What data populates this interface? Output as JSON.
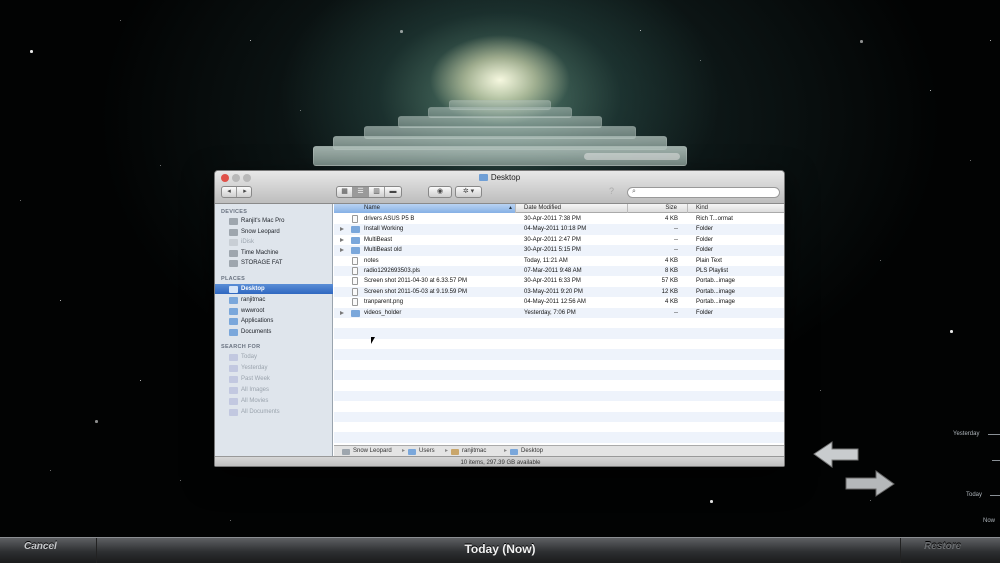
{
  "window": {
    "title": "Desktop",
    "search_placeholder": ""
  },
  "sidebar": {
    "devices_header": "DEVICES",
    "devices": [
      {
        "label": "Ranjit's Mac Pro",
        "dim": false
      },
      {
        "label": "Snow Leopard",
        "dim": false
      },
      {
        "label": "iDisk",
        "dim": true
      },
      {
        "label": "Time Machine",
        "dim": false
      },
      {
        "label": "STORAGE FAT",
        "dim": false
      }
    ],
    "places_header": "PLACES",
    "places": [
      {
        "label": "Desktop",
        "selected": true
      },
      {
        "label": "ranjitmac",
        "selected": false
      },
      {
        "label": "wwwroot",
        "selected": false
      },
      {
        "label": "Applications",
        "selected": false
      },
      {
        "label": "Documents",
        "selected": false
      }
    ],
    "search_header": "SEARCH FOR",
    "search_items": [
      "Today",
      "Yesterday",
      "Past Week",
      "All Images",
      "All Movies",
      "All Documents"
    ]
  },
  "columns": {
    "name": "Name",
    "date": "Date Modified",
    "size": "Size",
    "kind": "Kind"
  },
  "files": [
    {
      "name": "drivers ASUS P5 B",
      "date": "30-Apr-2011 7:38 PM",
      "size": "4 KB",
      "kind": "Rich T...ormat",
      "folder": false
    },
    {
      "name": "Install Working",
      "date": "04-May-2011 10:18 PM",
      "size": "--",
      "kind": "Folder",
      "folder": true
    },
    {
      "name": "MultiBeast",
      "date": "30-Apr-2011 2:47 PM",
      "size": "--",
      "kind": "Folder",
      "folder": true
    },
    {
      "name": "MultiBeast old",
      "date": "30-Apr-2011 5:15 PM",
      "size": "--",
      "kind": "Folder",
      "folder": true
    },
    {
      "name": "notes",
      "date": "Today, 11:21 AM",
      "size": "4 KB",
      "kind": "Plain Text",
      "folder": false
    },
    {
      "name": "radio1292693503.pls",
      "date": "07-Mar-2011 9:48 AM",
      "size": "8 KB",
      "kind": "PLS Playlist",
      "folder": false
    },
    {
      "name": "Screen shot 2011-04-30 at 6.33.57 PM",
      "date": "30-Apr-2011 6:33 PM",
      "size": "57 KB",
      "kind": "Portab...image",
      "folder": false
    },
    {
      "name": "Screen shot 2011-05-03 at 9.19.59 PM",
      "date": "03-May-2011 9:20 PM",
      "size": "12 KB",
      "kind": "Portab...image",
      "folder": false
    },
    {
      "name": "tranparent.png",
      "date": "04-May-2011 12:56 AM",
      "size": "4 KB",
      "kind": "Portab...image",
      "folder": false
    },
    {
      "name": "videos_holder",
      "date": "Yesterday, 7:06 PM",
      "size": "--",
      "kind": "Folder",
      "folder": true
    }
  ],
  "pathbar": [
    "Snow Leopard",
    "Users",
    "ranjitmac",
    "Desktop"
  ],
  "status": "10 items, 297.39 GB available",
  "timeline": {
    "yesterday": "Yesterday",
    "today": "Today",
    "now": "Now"
  },
  "bottom": {
    "cancel": "Cancel",
    "title": "Today (Now)",
    "restore": "Restore"
  },
  "colors": {
    "selection": "#3a74c8",
    "sidebar": "#dfe5ec",
    "folder": "#7aa7db"
  }
}
